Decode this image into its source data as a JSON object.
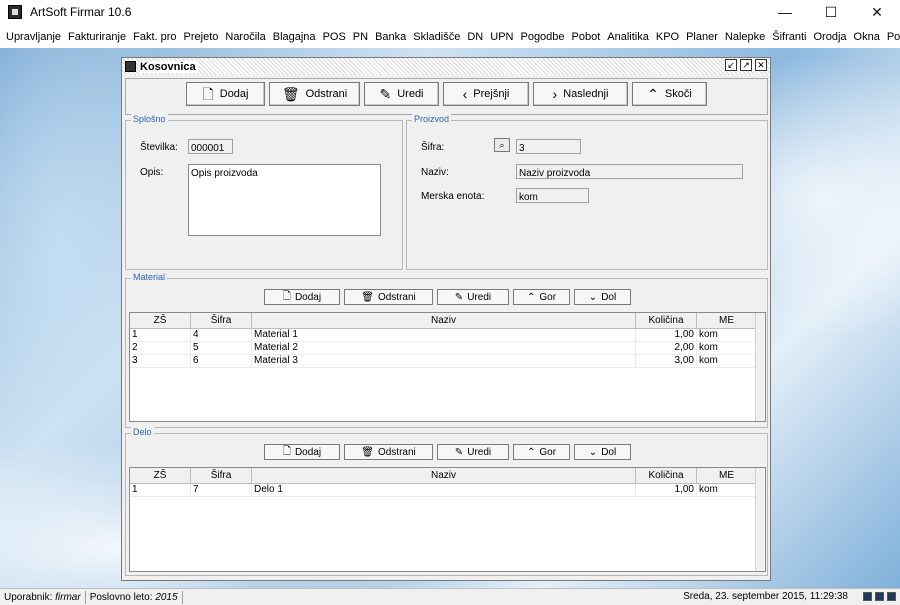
{
  "app": {
    "title": "ArtSoft Firmar 10.6"
  },
  "window_controls": {
    "minimize": "—",
    "maximize": "☐",
    "close": "✕"
  },
  "menu": [
    "Upravljanje",
    "Fakturiranje",
    "Fakt. pro",
    "Prejeto",
    "Naročila",
    "Blagajna",
    "POS",
    "PN",
    "Banka",
    "Skladišče",
    "DN",
    "UPN",
    "Pogodbe",
    "Pobot",
    "Analitika",
    "KPO",
    "Planer",
    "Nalepke",
    "Šifranti",
    "Orodja",
    "Okna",
    "Pomoč"
  ],
  "child": {
    "title": "Kosovnica",
    "toolbar": {
      "add": "Dodaj",
      "remove": "Odstrani",
      "edit": "Uredi",
      "prev": "Prejšnji",
      "next": "Naslednji",
      "jump": "Skoči"
    },
    "general": {
      "label": "Splošno",
      "number_label": "Številka:",
      "number_value": "000001",
      "desc_label": "Opis:",
      "desc_value": "Opis proizvoda"
    },
    "product": {
      "label": "Proizvod",
      "code_label": "Šifra:",
      "code_value": "3",
      "name_label": "Naziv:",
      "name_value": "Naziv proizvoda",
      "unit_label": "Merska enota:",
      "unit_value": "kom"
    },
    "material": {
      "label": "Material",
      "buttons": {
        "add": "Dodaj",
        "remove": "Odstrani",
        "edit": "Uredi",
        "up": "Gor",
        "down": "Dol"
      },
      "columns": [
        "ZŠ",
        "Šifra",
        "Naziv",
        "Količina",
        "ME"
      ],
      "rows": [
        [
          "1",
          "4",
          "Material 1",
          "1,00",
          "kom"
        ],
        [
          "2",
          "5",
          "Material 2",
          "2,00",
          "kom"
        ],
        [
          "3",
          "6",
          "Material 3",
          "3,00",
          "kom"
        ]
      ]
    },
    "work": {
      "label": "Delo",
      "buttons": {
        "add": "Dodaj",
        "remove": "Odstrani",
        "edit": "Uredi",
        "up": "Gor",
        "down": "Dol"
      },
      "columns": [
        "ZŠ",
        "Šifra",
        "Naziv",
        "Količina",
        "ME"
      ],
      "rows": [
        [
          "1",
          "7",
          "Delo 1",
          "1,00",
          "kom"
        ]
      ]
    }
  },
  "status": {
    "user_label": "Uporabnik:",
    "user": "firmar",
    "year_label": "Poslovno leto:",
    "year": "2015",
    "datetime": "Sreda, 23. september 2015, 11:29:38"
  }
}
